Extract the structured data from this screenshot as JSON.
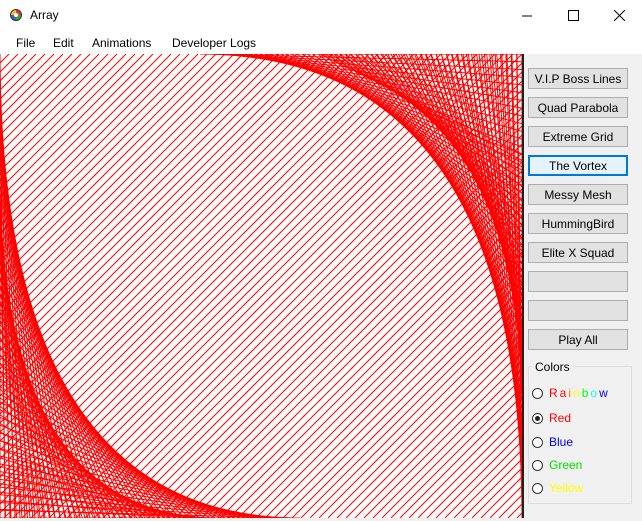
{
  "window": {
    "title": "Array"
  },
  "menu": [
    "File",
    "Edit",
    "Animations",
    "Developer Logs"
  ],
  "buttons": [
    "V.I.P Boss Lines",
    "Quad Parabola",
    "Extreme Grid",
    "The Vortex",
    "Messy Mesh",
    "HummingBird",
    "Elite X Squad",
    "",
    "",
    "Play All"
  ],
  "focused_button_index": 3,
  "colors_group": {
    "title": "Colors",
    "options": [
      {
        "label": "Rainbow",
        "color": "#ff0000",
        "checked": false
      },
      {
        "label": "Red",
        "color": "#ff0000",
        "checked": true
      },
      {
        "label": "Blue",
        "color": "#0000ff",
        "checked": false
      },
      {
        "label": "Green",
        "color": "#00ff00",
        "checked": false
      },
      {
        "label": "Yellow",
        "color": "#ffff00",
        "checked": false
      }
    ],
    "rainbow_letter_colors": [
      "#ff0000",
      "#ff0000",
      "#ff8000",
      "#ffff00",
      "#00ff00",
      "#00ffff",
      "#0000ff"
    ]
  },
  "drawing": {
    "pattern": "The Vortex",
    "line_color": "#ff0000"
  }
}
